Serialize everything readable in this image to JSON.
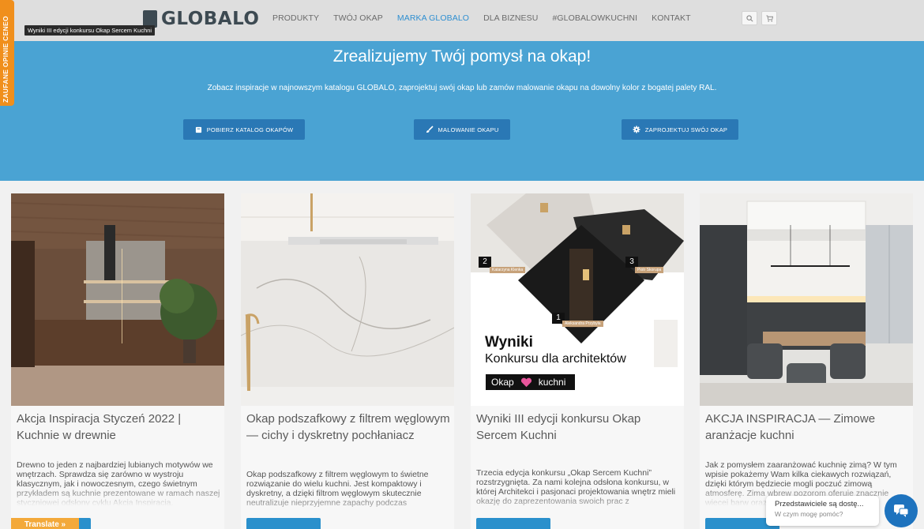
{
  "header": {
    "logo_text": "GLOBALO",
    "nav": [
      "PRODUKTY",
      "TWÓJ OKAP",
      "MARKA GLOBALO",
      "DLA BIZNESU",
      "#GLOBALOWKUCHNI",
      "KONTAKT"
    ],
    "active_nav": "MARKA GLOBALO",
    "search_icon": "search-icon",
    "cart_icon": "cart-icon"
  },
  "tooltip": "Wyniki III edycji konkursu Okap Sercem Kuchni",
  "side_badge": "ZAUFANE OPINIE CENEO",
  "hero": {
    "title": "Zrealizujemy Twój pomysł na okap!",
    "subtitle": "Zobacz inspiracje w najnowszym katalogu GLOBALO, zaprojektuj swój okap lub zamów malowanie okapu na dowolny kolor z bogatej palety RAL.",
    "buttons": [
      {
        "label": "POBIERZ KATALOG OKAPÓW",
        "icon": "book-icon"
      },
      {
        "label": "MALOWANIE OKAPU",
        "icon": "brush-icon"
      },
      {
        "label": "ZAPROJEKTUJ SWÓJ OKAP",
        "icon": "gear-icon"
      }
    ]
  },
  "cards": [
    {
      "title": "Akcja Inspiracja Styczeń 2022 | Kuchnie w drewnie",
      "excerpt": "Drewno to jeden z najbardziej lubianych motywów we wnętrzach. Sprawdza się zarówno w wystroju klasycznym, jak i nowoczesnym, czego świetnym przykładem są kuchnie prezentowane w ramach naszej styczniowej odsłony cyklu Akcja Inspiracja."
    },
    {
      "title": "Okap podszafkowy z filtrem węglowym — cichy i dyskretny pochłaniacz",
      "excerpt": "Okap podszafkowy z filtrem węglowym to świetne rozwiązanie do wielu kuchni. Jest kompaktowy i dyskretny, a dzięki filtrom węglowym skutecznie neutralizuje nieprzyjemne zapachy podczas"
    },
    {
      "title": "Wyniki III edycji konkursu Okap Sercem Kuchni",
      "excerpt": "Trzecia edycja konkursu „Okap Sercem Kuchni” rozstrzygnięta. Za nami kolejna odsłona konkursu, w której Architekci i pasjonaci projektowania wnętrz mieli okazję do zaprezentowania swoich prac z",
      "image_text": {
        "line1": "Wyniki",
        "line2": "Konkursu dla architektów",
        "tag_left": "Okap",
        "tag_right": "kuchni",
        "places": [
          {
            "num": "2",
            "name": "Katarzyna Klenka"
          },
          {
            "num": "3",
            "name": "Piotr Skorupa"
          },
          {
            "num": "1",
            "name": "Aleksandra Przybyła"
          }
        ]
      }
    },
    {
      "title": "AKCJA INSPIRACJA — Zimowe aranżacje kuchni",
      "excerpt": "Jak z pomysłem zaaranżować kuchnię zimą? W tym wpisie pokażemy Wam kilka ciekawych rozwiązań, dzięki którym będziecie mogli poczuć zimową atmosferę. Zima wbrew pozorom oferuje znacznie więcej barw oraz"
    }
  ],
  "translate_label": "Translate »",
  "chat": {
    "line1": "Przedstawiciele są dostę...",
    "line2": "W czym mogę pomóc?"
  },
  "colors": {
    "hero_bg": "#4aa3d3",
    "button": "#2a78b5",
    "accent_orange": "#f08f1c",
    "chat": "#1e73be"
  }
}
